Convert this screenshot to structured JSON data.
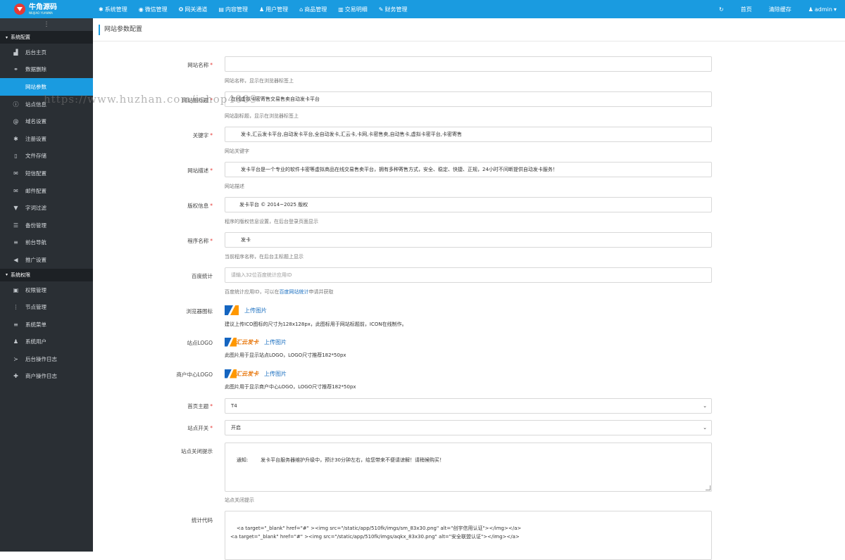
{
  "app": {
    "logo_title": "牛角源码",
    "logo_subtitle": "NIUJIAO YUANMA"
  },
  "topnav": [
    {
      "icon": "gear-icon",
      "glyph": "✱",
      "label": "系统管理"
    },
    {
      "icon": "wechat-icon",
      "glyph": "◉",
      "label": "微信管理"
    },
    {
      "icon": "gateway-icon",
      "glyph": "❂",
      "label": "网关通道"
    },
    {
      "icon": "content-icon",
      "glyph": "▤",
      "label": "内容管理"
    },
    {
      "icon": "users-icon",
      "glyph": "♟",
      "label": "用户管理"
    },
    {
      "icon": "shop-icon",
      "glyph": "⌂",
      "label": "商品管理"
    },
    {
      "icon": "chart-icon",
      "glyph": "▥",
      "label": "交易明细"
    },
    {
      "icon": "finance-icon",
      "glyph": "✎",
      "label": "财务管理"
    }
  ],
  "topright": {
    "refresh_glyph": "↻",
    "home": "首页",
    "clear_cache": "清除缓存",
    "user": "admin",
    "user_caret": "▾",
    "user_glyph": "♟"
  },
  "sidebar": {
    "toggle": "⋮",
    "group1": {
      "caret": "▾",
      "label": "系统配置"
    },
    "items1": [
      {
        "icon": "dashboard-icon",
        "glyph": "▟",
        "label": "后台主页",
        "active": false
      },
      {
        "icon": "link-icon",
        "glyph": "⚭",
        "label": "数据删除",
        "active": false
      },
      {
        "icon": "apple-icon",
        "glyph": "",
        "label": "网站参数",
        "active": true
      },
      {
        "icon": "info-icon",
        "glyph": "ⓘ",
        "label": "站点信息",
        "active": false
      },
      {
        "icon": "at-icon",
        "glyph": "@",
        "label": "域名设置",
        "active": false
      },
      {
        "icon": "gear-icon",
        "glyph": "✱",
        "label": "注册设置",
        "active": false
      },
      {
        "icon": "file-icon",
        "glyph": "▯",
        "label": "文件存储",
        "active": false
      },
      {
        "icon": "sms-icon",
        "glyph": "✉",
        "label": "短信配置",
        "active": false
      },
      {
        "icon": "mail-icon",
        "glyph": "✉",
        "label": "邮件配置",
        "active": false
      },
      {
        "icon": "filter-icon",
        "glyph": "▼",
        "label": "字词过滤",
        "active": false
      },
      {
        "icon": "database-icon",
        "glyph": "☰",
        "label": "备份管理",
        "active": false
      },
      {
        "icon": "menu-icon",
        "glyph": "≡",
        "label": "前台导航",
        "active": false
      },
      {
        "icon": "bullhorn-icon",
        "glyph": "◀",
        "label": "推广设置",
        "active": false
      }
    ],
    "group2": {
      "caret": "▾",
      "label": "系统权限"
    },
    "items2": [
      {
        "icon": "lock-icon",
        "glyph": "▣",
        "label": "权限管理"
      },
      {
        "icon": "dots-icon",
        "glyph": "⋮",
        "label": "节点管理"
      },
      {
        "icon": "list-icon",
        "glyph": "≡",
        "label": "系统菜单"
      },
      {
        "icon": "group-icon",
        "glyph": "♟",
        "label": "系统用户"
      },
      {
        "icon": "terminal-icon",
        "glyph": "≻",
        "label": "后台操作日志"
      },
      {
        "icon": "pin-icon",
        "glyph": "✚",
        "label": "商户操作日志"
      }
    ]
  },
  "page": {
    "title": "网站参数配置",
    "watermark": "https://www.huzhan.com/ishop4009"
  },
  "form": {
    "site_name": {
      "label": "网站名称",
      "value": "",
      "help": "网站名称，显示在浏览器标签上"
    },
    "site_subtitle": {
      "label": "网站副标题",
      "value": "在线虚拟卡密寄售交易售卖自动发卡平台",
      "help": "网站副标题，显示在浏览器标签上"
    },
    "keywords": {
      "label": "关键字",
      "value": "发卡,汇云发卡平台,自动发卡平台,全自动发卡,汇云卡,卡网,卡密售卖,自动售卡,虚拟卡密平台,卡密寄售",
      "help": "网站关键字"
    },
    "description": {
      "label": "网站描述",
      "value": "发卡平台是一个专业的软件卡密等虚拟商品在线交易售卖平台，拥有多种寄售方式，安全、稳定、快捷、正规，24小时不间断提供自动发卡服务！",
      "help": "网站描述"
    },
    "copyright": {
      "label": "版权信息",
      "value": "发卡平台 © 2014~2025 版权",
      "help": "程序的版权信息设置，在后台登录页面显示"
    },
    "program_name": {
      "label": "程序名称",
      "value": "发卡",
      "help": "当前程序名称，在后台主标题上显示"
    },
    "baidu_stats": {
      "label": "百度统计",
      "placeholder": "请输入32位百度统计应用ID",
      "help_prefix": "百度统计应用ID，可以在",
      "help_link": "百度网站统计",
      "help_suffix": "申请并获取"
    },
    "favicon": {
      "label": "浏览器图标",
      "upload": "上传图片",
      "help": "建议上传ICO图标的尺寸为128x128px，此图标用于网站标题前，ICON在线制作。"
    },
    "site_logo": {
      "label": "站点LOGO",
      "logo_text": "汇云发卡",
      "upload": "上传图片",
      "help": "此图片用于显示站点LOGO，LOGO尺寸推荐182*50px"
    },
    "merchant_logo": {
      "label": "商户中心LOGO",
      "logo_text": "汇云发卡",
      "upload": "上传图片",
      "help": "此图片用于显示商户中心LOGO，LOGO尺寸推荐182*50px"
    },
    "home_theme": {
      "label": "首页主题",
      "value": "T4",
      "caret": "⌄"
    },
    "site_switch": {
      "label": "站点开关",
      "value": "开启",
      "caret": "⌄"
    },
    "close_notice": {
      "label": "站点关闭提示",
      "value": "通知:        发卡平台服务器维护升级中，预计30分钟左右，给您带来不便请谅解！请稍候购买！",
      "help": "站点关闭提示"
    },
    "stats_code": {
      "label": "统计代码",
      "value": "<a target=\"_blank\" href=\"#\" ><img src=\"/static/app/510fk/imgs/sm_83x30.png\" alt=\"创宇信用认证\"></img></a>\n<a target=\"_blank\" href=\"#\" ><img src=\"/static/app/510fk/imgs/aqkx_83x30.png\" alt=\"安全联盟认证\"></img></a>"
    },
    "required_mark": "*"
  },
  "colors": {
    "accent": "#1a9be0",
    "sidebar_bg": "#2a2f34",
    "required": "#e53935"
  }
}
